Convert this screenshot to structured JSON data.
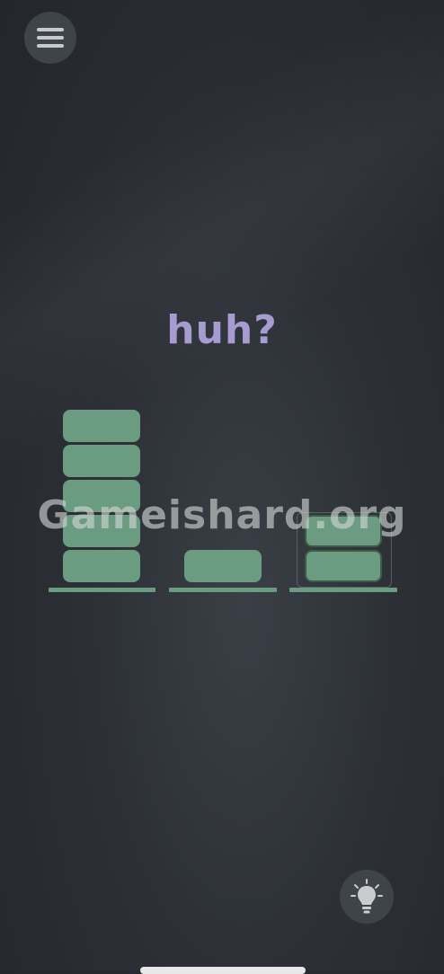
{
  "level": {
    "title": "huh?"
  },
  "watermark": {
    "text": "Gameishard.org"
  },
  "menu_button": {
    "icon": "hamburger-menu-icon"
  },
  "hint_button": {
    "icon": "lightbulb-icon"
  },
  "stacks": [
    {
      "blocks": 5
    },
    {
      "blocks": 1
    },
    {
      "blocks": 2,
      "highlighted": true
    }
  ],
  "colors": {
    "background": "#2a2d33",
    "block": "#6b9b80",
    "title": "#a89bd0",
    "button_bg": "#3f434a"
  }
}
